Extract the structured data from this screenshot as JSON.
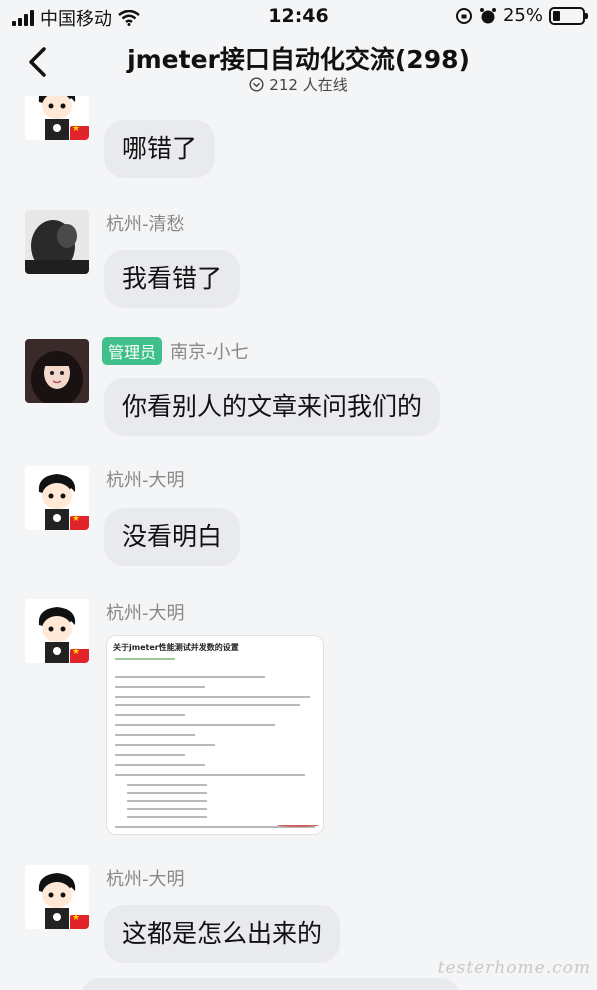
{
  "status_bar": {
    "carrier": "中国移动",
    "time": "12:46",
    "battery_percent": "25%",
    "battery_level": 0.25,
    "icons": [
      "signal-icon",
      "wifi-icon",
      "rotation-lock-icon",
      "alarm-icon",
      "battery-icon"
    ]
  },
  "header": {
    "title": "jmeter接口自动化交流(298)",
    "online": "212 人在线",
    "back_icon": "chevron-left-icon",
    "online_icon": "chevron-down-circle-icon"
  },
  "messages": [
    {
      "sender": "",
      "text": "哪错了",
      "avatar": "cartoon-avatar"
    },
    {
      "sender": "杭州-清愁",
      "text": "我看错了",
      "avatar": "photo-avatar-dark"
    },
    {
      "sender": "南京-小七",
      "badge": "管理员",
      "text": "你看别人的文章来问我们的",
      "avatar": "photo-avatar-girl"
    },
    {
      "sender": "杭州-大明",
      "text": "没看明白",
      "avatar": "cartoon-avatar"
    },
    {
      "sender": "杭州-大明",
      "image_title": "关于jmeter性能测试并发数的设置",
      "avatar": "cartoon-avatar"
    },
    {
      "sender": "杭州-大明",
      "text": "这都是怎么出来的",
      "avatar": "cartoon-avatar"
    }
  ],
  "watermark": "testerhome.com",
  "colors": {
    "bubble": "#e9eaee",
    "admin_badge": "#3fbf8a",
    "background": "#f4f5f7"
  }
}
